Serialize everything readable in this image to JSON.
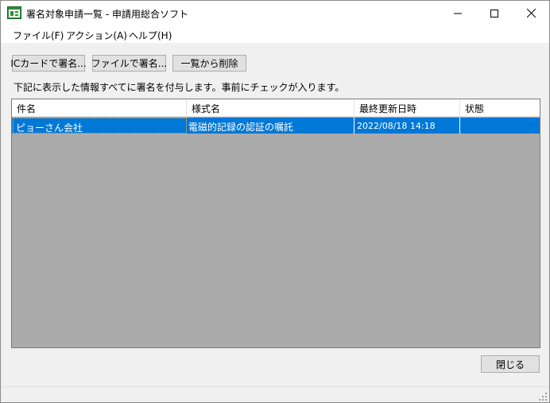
{
  "window": {
    "title": "署名対象申請一覧 - 申請用総合ソフト",
    "app_icon": "green-window-app-icon",
    "controls": [
      "minimize-icon",
      "maximize-icon",
      "close-icon"
    ]
  },
  "menu": {
    "file": "ファイル(F)",
    "action": "アクション(A)",
    "help": "ヘルプ(H)"
  },
  "toolbar": {
    "ic_card_sign": "ICカードで署名...",
    "file_sign": "ファイルで署名...",
    "remove_from_list": "一覧から削除"
  },
  "info": "下記に表示した情報すべてに署名を付与します。事前にチェックが入ります。",
  "list": {
    "columns": [
      "件名",
      "様式名",
      "最終更新日時",
      "状態"
    ],
    "rows": [
      {
        "subject": "ピョーさん会社",
        "form_name": "電磁的記録の認証の嘱託",
        "updated": "2022/08/18 14:18",
        "status": ""
      }
    ]
  },
  "footer": {
    "close_label": "閉じる"
  },
  "colors": {
    "selection": "#0078d7",
    "list_background": "#ababab",
    "window_background": "#f0f0f0"
  }
}
